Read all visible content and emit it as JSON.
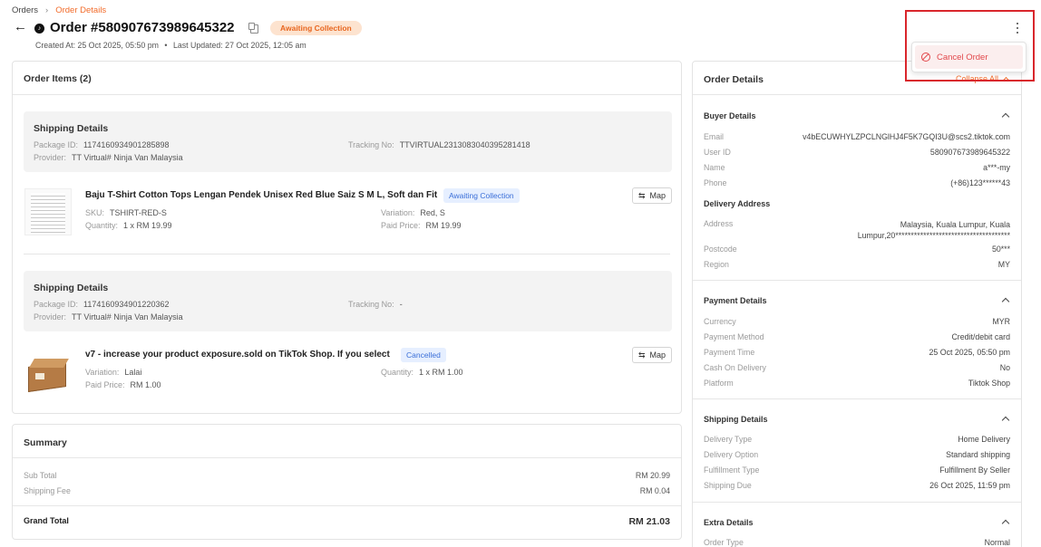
{
  "breadcrumb": {
    "root": "Orders",
    "current": "Order Details"
  },
  "header": {
    "title": "Order #580907673989645322",
    "status": "Awaiting Collection",
    "created": "Created At: 25 Oct 2025, 05:50 pm",
    "updated": "Last Updated: 27 Oct 2025, 12:05 am"
  },
  "menu": {
    "cancel_label": "Cancel Order"
  },
  "order_items": {
    "title": "Order Items (2)",
    "groups": [
      {
        "shipping_title": "Shipping Details",
        "package_label": "Package ID:",
        "package_id": "1174160934901285898",
        "tracking_label": "Tracking No:",
        "tracking_no": "TTVIRTUAL2313083040395281418",
        "provider_label": "Provider:",
        "provider": "TT Virtual# Ninja Van Malaysia",
        "product": {
          "name": "Baju T-Shirt Cotton Tops Lengan Pendek Unisex Red Blue Saiz S M L, Soft dan Fit",
          "status": "Awaiting Collection",
          "a_label": "SKU:",
          "a_value": "TSHIRT-RED-S",
          "b_label": "Variation:",
          "b_value": "Red, S",
          "c_label": "Quantity:",
          "c_value": "1 x RM 19.99",
          "d_label": "Paid Price:",
          "d_value": "RM 19.99",
          "map": "Map"
        }
      },
      {
        "shipping_title": "Shipping Details",
        "package_label": "Package ID:",
        "package_id": "1174160934901220362",
        "tracking_label": "Tracking No:",
        "tracking_no": "-",
        "provider_label": "Provider:",
        "provider": "TT Virtual# Ninja Van Malaysia",
        "product": {
          "name": "v7 - increase your product exposure.sold on TikTok Shop. If you select",
          "status": "Cancelled",
          "a_label": "Variation:",
          "a_value": "Lalai",
          "b_label": "Quantity:",
          "b_value": "1 x RM 1.00",
          "c_label": "Paid Price:",
          "c_value": "RM 1.00",
          "map": "Map"
        }
      }
    ]
  },
  "summary": {
    "title": "Summary",
    "subtotal_label": "Sub Total",
    "subtotal": "RM 20.99",
    "shipping_label": "Shipping Fee",
    "shipping": "RM 0.04",
    "grand_label": "Grand Total",
    "grand": "RM 21.03"
  },
  "details": {
    "title": "Order Details",
    "collapse_all": "Collapse All",
    "buyer": {
      "title": "Buyer Details",
      "rows": [
        {
          "k": "Email",
          "v": "v4bECUWHYLZPCLNGlHJ4F5K7GQI3U@scs2.tiktok.com"
        },
        {
          "k": "User ID",
          "v": "580907673989645322"
        },
        {
          "k": "Name",
          "v": "a***-my"
        },
        {
          "k": "Phone",
          "v": "(+86)123******43"
        }
      ]
    },
    "delivery": {
      "title": "Delivery Address",
      "address_label": "Address",
      "address_line1": "Malaysia, Kuala Lumpur, Kuala",
      "address_line2": "Lumpur,20*************************************",
      "postcode_label": "Postcode",
      "postcode": "50***",
      "region_label": "Region",
      "region": "MY"
    },
    "payment": {
      "title": "Payment Details",
      "rows": [
        {
          "k": "Currency",
          "v": "MYR"
        },
        {
          "k": "Payment Method",
          "v": "Credit/debit card"
        },
        {
          "k": "Payment Time",
          "v": "25 Oct 2025, 05:50 pm"
        },
        {
          "k": "Cash On Delivery",
          "v": "No"
        },
        {
          "k": "Platform",
          "v": "Tiktok Shop"
        }
      ]
    },
    "shipping": {
      "title": "Shipping Details",
      "rows": [
        {
          "k": "Delivery Type",
          "v": "Home Delivery"
        },
        {
          "k": "Delivery Option",
          "v": "Standard shipping"
        },
        {
          "k": "Fulfillment Type",
          "v": "Fulfillment By Seller"
        },
        {
          "k": "Shipping Due",
          "v": "26 Oct 2025, 11:59 pm"
        }
      ]
    },
    "extra": {
      "title": "Extra Details",
      "rows": [
        {
          "k": "Order Type",
          "v": "Normal"
        }
      ]
    }
  },
  "colors": {
    "accent": "#f26b2a",
    "highlight_box": "#d9262c",
    "badge_orange_bg": "#fde3cf",
    "badge_blue_bg": "#e6efff"
  }
}
